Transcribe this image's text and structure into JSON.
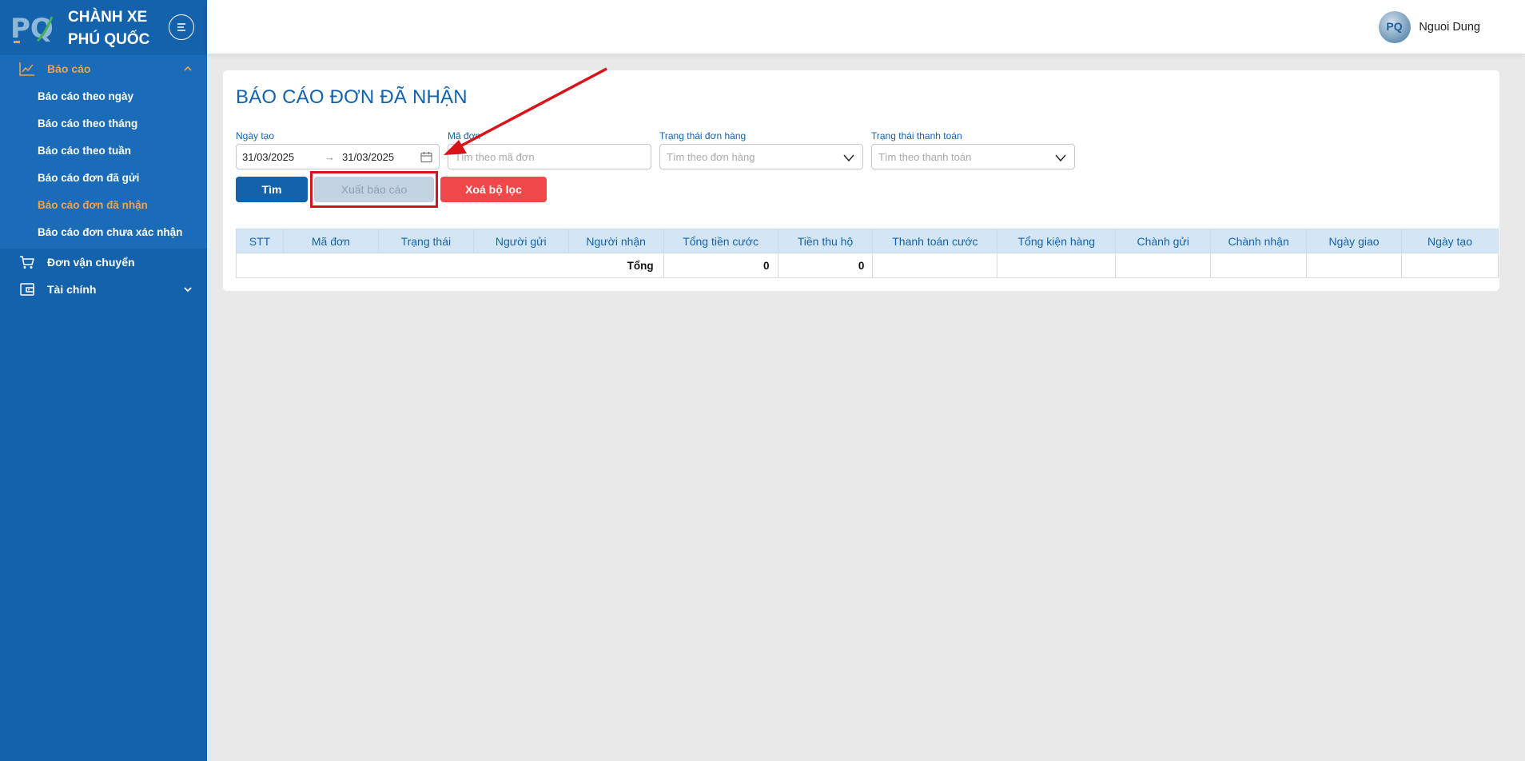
{
  "brand": {
    "line1": "CHÀNH XE",
    "line2": "PHÚ QUỐC",
    "logo_text": "PQ"
  },
  "sidebar": {
    "items": [
      {
        "label": "Báo cáo",
        "icon": "chart-line-icon",
        "expanded": true
      },
      {
        "label": "Đơn vận chuyển",
        "icon": "cart-icon"
      },
      {
        "label": "Tài chính",
        "icon": "wallet-icon"
      }
    ],
    "report_submenu": [
      "Báo cáo theo ngày",
      "Báo cáo theo tháng",
      "Báo cáo theo tuần",
      "Báo cáo đơn đã gửi",
      "Báo cáo đơn đã nhận",
      "Báo cáo đơn chưa xác nhận"
    ]
  },
  "header": {
    "user_name": "Nguoi Dung",
    "avatar_text": "PQ"
  },
  "page": {
    "title": "BÁO CÁO ĐƠN ĐÃ NHẬN",
    "filters": {
      "date_label": "Ngày tạo",
      "date_from": "31/03/2025",
      "date_to": "31/03/2025",
      "date_separator": "→",
      "order_code_label": "Mã đơn",
      "order_code_placeholder": "Tìm theo mã đơn",
      "order_status_label": "Trạng thái đơn hàng",
      "order_status_placeholder": "Tìm theo đơn hàng",
      "payment_status_label": "Trạng thái thanh toán",
      "payment_status_placeholder": "Tìm theo thanh toán"
    },
    "buttons": {
      "search": "Tìm",
      "export": "Xuất báo cáo",
      "clear": "Xoá bộ lọc"
    },
    "table": {
      "columns": [
        "STT",
        "Mã đơn",
        "Trạng thái",
        "Người gửi",
        "Người nhận",
        "Tổng tiền cước",
        "Tiền thu hộ",
        "Thanh toán cước",
        "Tổng kiện hàng",
        "Chành gửi",
        "Chành nhận",
        "Ngày giao",
        "Ngày tạo"
      ],
      "total_label": "Tổng",
      "total_freight": "0",
      "total_cod": "0"
    }
  },
  "colors": {
    "primary": "#1462ab",
    "accent": "#f5a149",
    "danger": "#f04848",
    "annotation": "#d8141b"
  }
}
